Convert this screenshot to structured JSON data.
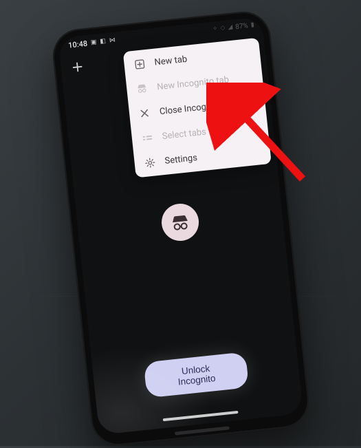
{
  "status": {
    "time": "10:48",
    "battery": "87%"
  },
  "menu": {
    "items": [
      {
        "label": "New tab",
        "enabled": true
      },
      {
        "label": "New Incognito tab",
        "enabled": false
      },
      {
        "label": "Close Incognito tabs",
        "enabled": true
      },
      {
        "label": "Select tabs",
        "enabled": false
      },
      {
        "label": "Settings",
        "enabled": true
      }
    ]
  },
  "unlock_label": "Unlock Incognito"
}
